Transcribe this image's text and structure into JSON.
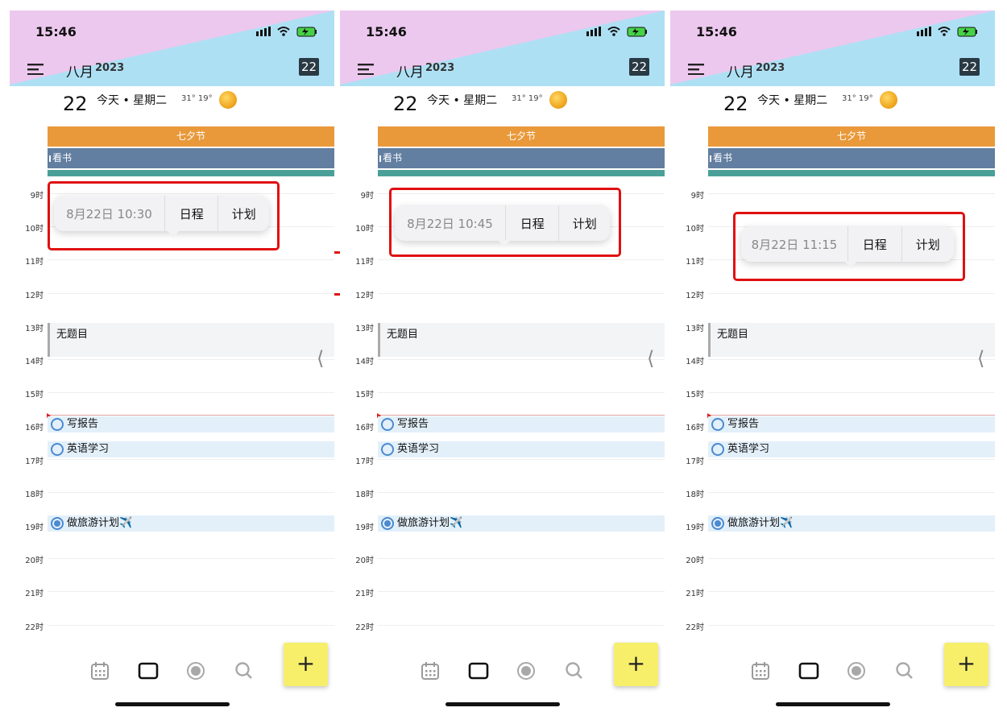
{
  "colors": {
    "header_bg": "#aee0f4",
    "header_pink": "#ecc8ee",
    "festival": "#e9993a",
    "book": "#627ea0",
    "task_bg": "#e3f0fa",
    "accent_blue": "#4a8ad0",
    "add_button": "#f7ef6a",
    "highlight_box": "#e01010"
  },
  "screens": [
    {
      "status_time": "15:46",
      "month": "八月",
      "year": "2023",
      "day_badge": "22",
      "big_date": "22",
      "today_label": "今天 • 星期二",
      "temperature": "31° 19°",
      "allday": {
        "festival": "七夕节",
        "book": "看书"
      },
      "hours": [
        "9时",
        "10时",
        "11时",
        "12时",
        "13时",
        "14时",
        "15时",
        "16时",
        "17时",
        "18时",
        "19时",
        "20时",
        "21时",
        "22时"
      ],
      "popup": {
        "time": "8月22日 10:30",
        "schedule_btn": "日程",
        "plan_btn": "计划"
      },
      "event_untitled": "无题目",
      "tasks": [
        {
          "label": "写报告"
        },
        {
          "label": "英语学习"
        },
        {
          "label": "做旅游计划✈️"
        }
      ],
      "tabs": [
        "calendar-icon",
        "square-icon",
        "record-icon",
        "search-icon"
      ],
      "add_label": "+"
    },
    {
      "status_time": "15:46",
      "month": "八月",
      "year": "2023",
      "day_badge": "22",
      "big_date": "22",
      "today_label": "今天 • 星期二",
      "temperature": "31° 19°",
      "allday": {
        "festival": "七夕节",
        "book": "看书"
      },
      "hours": [
        "9时",
        "10时",
        "11时",
        "12时",
        "13时",
        "14时",
        "15时",
        "16时",
        "17时",
        "18时",
        "19时",
        "20时",
        "21时",
        "22时"
      ],
      "popup": {
        "time": "8月22日 10:45",
        "schedule_btn": "日程",
        "plan_btn": "计划"
      },
      "event_untitled": "无题目",
      "tasks": [
        {
          "label": "写报告"
        },
        {
          "label": "英语学习"
        },
        {
          "label": "做旅游计划✈️"
        }
      ],
      "tabs": [
        "calendar-icon",
        "square-icon",
        "record-icon",
        "search-icon"
      ],
      "add_label": "+"
    },
    {
      "status_time": "15:46",
      "month": "八月",
      "year": "2023",
      "day_badge": "22",
      "big_date": "22",
      "today_label": "今天 • 星期二",
      "temperature": "31° 19°",
      "allday": {
        "festival": "七夕节",
        "book": "看书"
      },
      "hours": [
        "9时",
        "10时",
        "11时",
        "12时",
        "13时",
        "14时",
        "15时",
        "16时",
        "17时",
        "18时",
        "19时",
        "20时",
        "21时",
        "22时"
      ],
      "popup": {
        "time": "8月22日 11:15",
        "schedule_btn": "日程",
        "plan_btn": "计划"
      },
      "event_untitled": "无题目",
      "tasks": [
        {
          "label": "写报告"
        },
        {
          "label": "英语学习"
        },
        {
          "label": "做旅游计划✈️"
        }
      ],
      "tabs": [
        "calendar-icon",
        "square-icon",
        "record-icon",
        "search-icon"
      ],
      "add_label": "+"
    }
  ]
}
